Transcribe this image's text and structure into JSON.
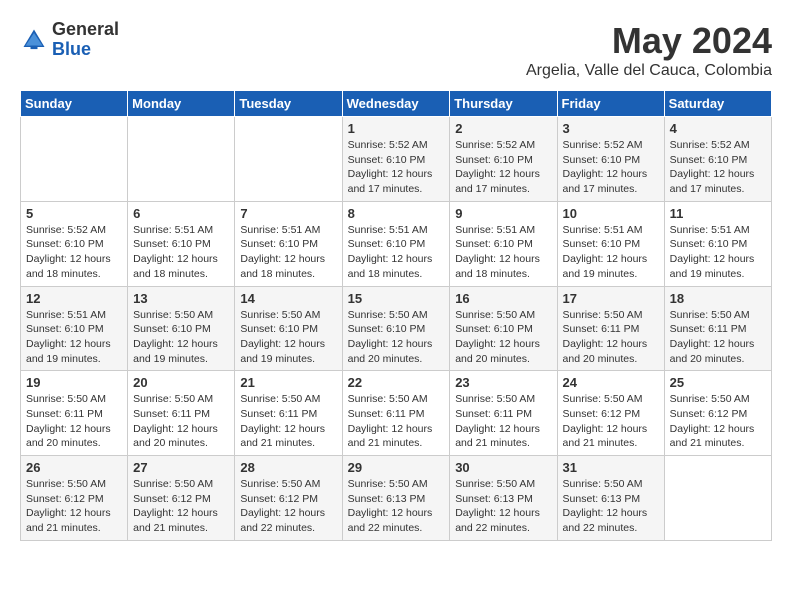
{
  "header": {
    "logo_general": "General",
    "logo_blue": "Blue",
    "month": "May 2024",
    "location": "Argelia, Valle del Cauca, Colombia"
  },
  "days_of_week": [
    "Sunday",
    "Monday",
    "Tuesday",
    "Wednesday",
    "Thursday",
    "Friday",
    "Saturday"
  ],
  "weeks": [
    [
      {
        "day": "",
        "info": ""
      },
      {
        "day": "",
        "info": ""
      },
      {
        "day": "",
        "info": ""
      },
      {
        "day": "1",
        "info": "Sunrise: 5:52 AM\nSunset: 6:10 PM\nDaylight: 12 hours\nand 17 minutes."
      },
      {
        "day": "2",
        "info": "Sunrise: 5:52 AM\nSunset: 6:10 PM\nDaylight: 12 hours\nand 17 minutes."
      },
      {
        "day": "3",
        "info": "Sunrise: 5:52 AM\nSunset: 6:10 PM\nDaylight: 12 hours\nand 17 minutes."
      },
      {
        "day": "4",
        "info": "Sunrise: 5:52 AM\nSunset: 6:10 PM\nDaylight: 12 hours\nand 17 minutes."
      }
    ],
    [
      {
        "day": "5",
        "info": "Sunrise: 5:52 AM\nSunset: 6:10 PM\nDaylight: 12 hours\nand 18 minutes."
      },
      {
        "day": "6",
        "info": "Sunrise: 5:51 AM\nSunset: 6:10 PM\nDaylight: 12 hours\nand 18 minutes."
      },
      {
        "day": "7",
        "info": "Sunrise: 5:51 AM\nSunset: 6:10 PM\nDaylight: 12 hours\nand 18 minutes."
      },
      {
        "day": "8",
        "info": "Sunrise: 5:51 AM\nSunset: 6:10 PM\nDaylight: 12 hours\nand 18 minutes."
      },
      {
        "day": "9",
        "info": "Sunrise: 5:51 AM\nSunset: 6:10 PM\nDaylight: 12 hours\nand 18 minutes."
      },
      {
        "day": "10",
        "info": "Sunrise: 5:51 AM\nSunset: 6:10 PM\nDaylight: 12 hours\nand 19 minutes."
      },
      {
        "day": "11",
        "info": "Sunrise: 5:51 AM\nSunset: 6:10 PM\nDaylight: 12 hours\nand 19 minutes."
      }
    ],
    [
      {
        "day": "12",
        "info": "Sunrise: 5:51 AM\nSunset: 6:10 PM\nDaylight: 12 hours\nand 19 minutes."
      },
      {
        "day": "13",
        "info": "Sunrise: 5:50 AM\nSunset: 6:10 PM\nDaylight: 12 hours\nand 19 minutes."
      },
      {
        "day": "14",
        "info": "Sunrise: 5:50 AM\nSunset: 6:10 PM\nDaylight: 12 hours\nand 19 minutes."
      },
      {
        "day": "15",
        "info": "Sunrise: 5:50 AM\nSunset: 6:10 PM\nDaylight: 12 hours\nand 20 minutes."
      },
      {
        "day": "16",
        "info": "Sunrise: 5:50 AM\nSunset: 6:10 PM\nDaylight: 12 hours\nand 20 minutes."
      },
      {
        "day": "17",
        "info": "Sunrise: 5:50 AM\nSunset: 6:11 PM\nDaylight: 12 hours\nand 20 minutes."
      },
      {
        "day": "18",
        "info": "Sunrise: 5:50 AM\nSunset: 6:11 PM\nDaylight: 12 hours\nand 20 minutes."
      }
    ],
    [
      {
        "day": "19",
        "info": "Sunrise: 5:50 AM\nSunset: 6:11 PM\nDaylight: 12 hours\nand 20 minutes."
      },
      {
        "day": "20",
        "info": "Sunrise: 5:50 AM\nSunset: 6:11 PM\nDaylight: 12 hours\nand 20 minutes."
      },
      {
        "day": "21",
        "info": "Sunrise: 5:50 AM\nSunset: 6:11 PM\nDaylight: 12 hours\nand 21 minutes."
      },
      {
        "day": "22",
        "info": "Sunrise: 5:50 AM\nSunset: 6:11 PM\nDaylight: 12 hours\nand 21 minutes."
      },
      {
        "day": "23",
        "info": "Sunrise: 5:50 AM\nSunset: 6:11 PM\nDaylight: 12 hours\nand 21 minutes."
      },
      {
        "day": "24",
        "info": "Sunrise: 5:50 AM\nSunset: 6:12 PM\nDaylight: 12 hours\nand 21 minutes."
      },
      {
        "day": "25",
        "info": "Sunrise: 5:50 AM\nSunset: 6:12 PM\nDaylight: 12 hours\nand 21 minutes."
      }
    ],
    [
      {
        "day": "26",
        "info": "Sunrise: 5:50 AM\nSunset: 6:12 PM\nDaylight: 12 hours\nand 21 minutes."
      },
      {
        "day": "27",
        "info": "Sunrise: 5:50 AM\nSunset: 6:12 PM\nDaylight: 12 hours\nand 21 minutes."
      },
      {
        "day": "28",
        "info": "Sunrise: 5:50 AM\nSunset: 6:12 PM\nDaylight: 12 hours\nand 22 minutes."
      },
      {
        "day": "29",
        "info": "Sunrise: 5:50 AM\nSunset: 6:13 PM\nDaylight: 12 hours\nand 22 minutes."
      },
      {
        "day": "30",
        "info": "Sunrise: 5:50 AM\nSunset: 6:13 PM\nDaylight: 12 hours\nand 22 minutes."
      },
      {
        "day": "31",
        "info": "Sunrise: 5:50 AM\nSunset: 6:13 PM\nDaylight: 12 hours\nand 22 minutes."
      },
      {
        "day": "",
        "info": ""
      }
    ]
  ]
}
